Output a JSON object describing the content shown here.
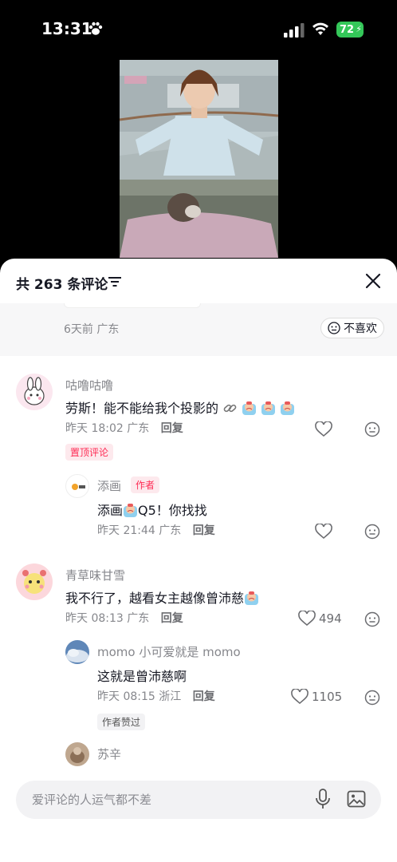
{
  "status_bar": {
    "time": "13:31",
    "battery": "72"
  },
  "panel": {
    "comment_count_label": "共 263 条评论",
    "prev_meta": "6天前 广东",
    "dislike_label": "不喜欢"
  },
  "comments": [
    {
      "user": "咕噜咕噜",
      "text": "劳斯！能不能给我个投影的",
      "meta": "昨天 18:02 广东",
      "reply": "回复",
      "tag": "置顶评论"
    },
    {
      "user": "添画",
      "author_tag": "作者",
      "text_prefix": "添画",
      "text_suffix": "Q5！你找找",
      "meta": "昨天 21:44 广东",
      "reply": "回复"
    },
    {
      "user": "青草味甘雪",
      "text": "我不行了，越看女主越像曾沛慈",
      "meta": "昨天 08:13 广东",
      "reply": "回复",
      "likes": "494"
    },
    {
      "user": "momo 小可爱就是 momo",
      "text": "这就是曾沛慈啊",
      "meta": "昨天 08:15 浙江",
      "reply": "回复",
      "likes": "1105",
      "tag": "作者赞过"
    },
    {
      "user": "苏辛"
    }
  ],
  "input": {
    "placeholder": "爱评论的人运气都不差"
  },
  "colors": {
    "accent": "#fe2c55",
    "battery": "#34c759"
  }
}
